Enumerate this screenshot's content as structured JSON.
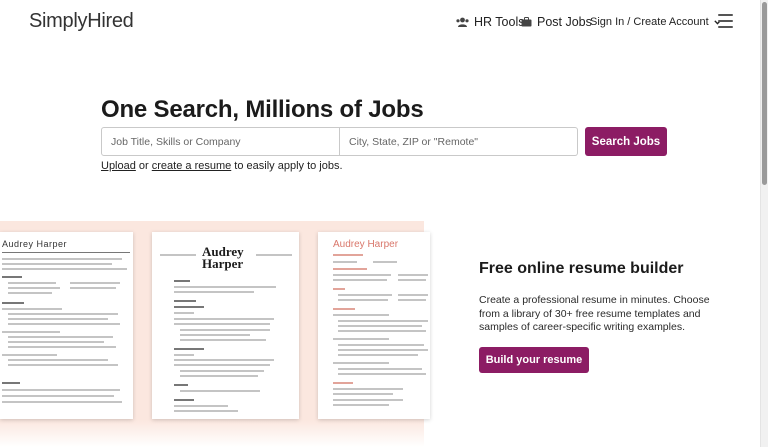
{
  "header": {
    "logo": "SimplyHired",
    "nav": {
      "hr_tools": "HR Tools",
      "post_jobs": "Post Jobs",
      "sign_in": "Sign In / Create Account"
    },
    "icons": [
      "users-icon",
      "briefcase-icon",
      "chevron-down-icon",
      "hamburger-menu-icon"
    ]
  },
  "hero": {
    "title": "One Search, Millions of Jobs",
    "what_placeholder": "Job Title, Skills or Company",
    "where_placeholder": "City, State, ZIP or \"Remote\"",
    "search_button": "Search Jobs",
    "upload_link": "Upload",
    "or_text": " or ",
    "create_link": "create a resume",
    "suffix_text": " to easily apply to jobs."
  },
  "resume_builder": {
    "templates": {
      "one": {
        "name": "Audrey  Harper"
      },
      "two": {
        "name_first": "Audrey",
        "name_last": "Harper"
      },
      "three": {
        "name": "Audrey Harper"
      }
    },
    "title": "Free online resume builder",
    "description": "Create a professional resume in minutes. Choose from a library of 30+ free resume templates and samples of career-specific writing examples.",
    "button": "Build your resume"
  },
  "colors": {
    "brand": "#8c1c64",
    "band": "#fbe7df"
  }
}
